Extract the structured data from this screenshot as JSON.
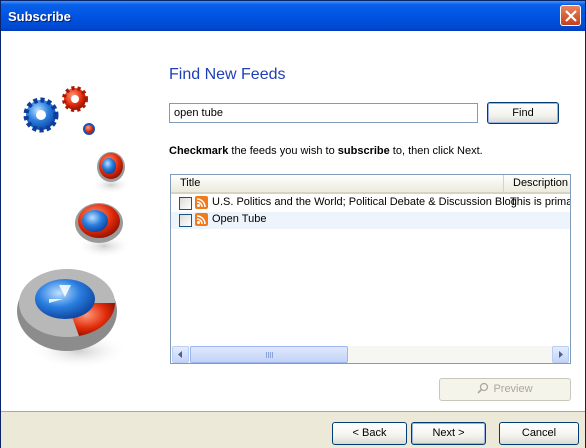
{
  "window": {
    "title": "Subscribe"
  },
  "main": {
    "heading": "Find New Feeds",
    "search": {
      "value": "open tube",
      "placeholder": ""
    },
    "find_label": "Find",
    "instruction": {
      "part1": "Checkmark",
      "part2": " the feeds you wish to ",
      "part3": "subscribe",
      "part4": " to, then click Next."
    },
    "list": {
      "columns": [
        "Title",
        "Description"
      ],
      "rows": [
        {
          "title": "U.S. Politics and the World; Political Debate & Discussion Blog",
          "description": "This is primar",
          "checked": false
        },
        {
          "title": "Open Tube",
          "description": "",
          "checked": false
        }
      ]
    },
    "preview_label": "Preview"
  },
  "footer": {
    "back_label": "< Back",
    "next_label": "Next >",
    "cancel_label": "Cancel"
  },
  "colors": {
    "accent": "#1f3fb7",
    "titlebar": "#0054e3",
    "footer": "#ece9d8"
  }
}
